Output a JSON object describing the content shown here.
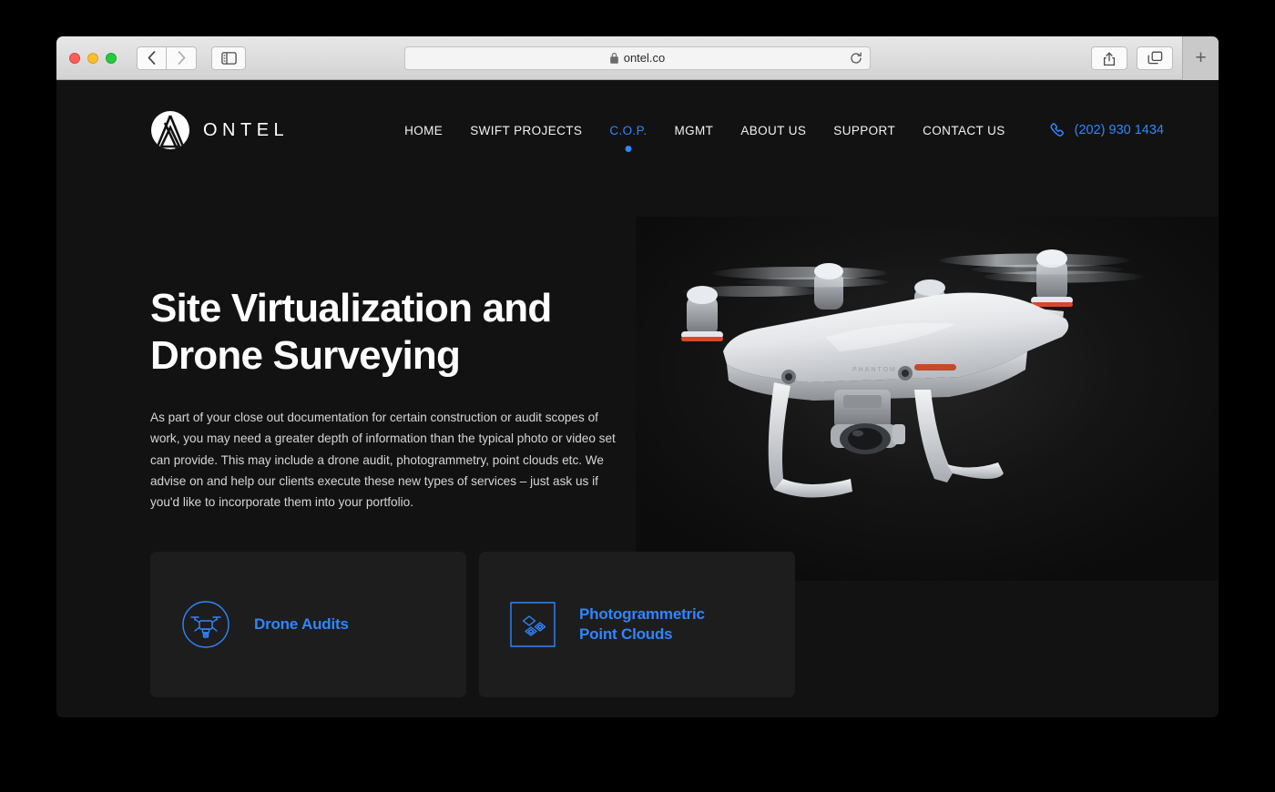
{
  "browser": {
    "url": "ontel.co",
    "lock_icon": "lock-icon",
    "back_icon": "chevron-left-icon",
    "forward_icon": "chevron-right-icon",
    "sidebar_icon": "sidebar-toggle-icon",
    "reload_icon": "reload-icon",
    "share_icon": "share-icon",
    "tabs_icon": "tab-overview-icon",
    "newtab_label": "+"
  },
  "site": {
    "brand": {
      "name": "ONTEL",
      "logo_icon": "ontel-logo-icon"
    },
    "nav": [
      {
        "label": "HOME",
        "active": false
      },
      {
        "label": "SWIFT PROJECTS",
        "active": false
      },
      {
        "label": "C.O.P.",
        "active": true
      },
      {
        "label": "MGMT",
        "active": false
      },
      {
        "label": "ABOUT US",
        "active": false
      },
      {
        "label": "SUPPORT",
        "active": false
      },
      {
        "label": "CONTACT US",
        "active": false
      }
    ],
    "phone": {
      "number": "(202) 930 1434",
      "icon": "phone-icon"
    },
    "hero": {
      "title_line1": "Site Virtualization and",
      "title_line2": "Drone Surveying",
      "paragraph": "As part of your close out documentation for certain construction or audit scopes of work, you may need a greater depth of information than the typical photo or video set can provide. This may include a drone audit, photogrammetry, point clouds etc. We advise on and help our clients execute these new types of services – just ask us if you'd like to incorporate them into your portfolio.",
      "image_alt": "white quadcopter drone in flight on black background"
    },
    "cards": [
      {
        "label": "Drone Audits",
        "icon": "drone-circle-icon"
      },
      {
        "label_line1": "Photogrammetric",
        "label_line2": "Point Clouds",
        "icon": "point-cloud-square-icon"
      }
    ],
    "colors": {
      "accent": "#2f86ff",
      "page_bg": "#121212",
      "card_bg": "#1d1d1d"
    }
  }
}
